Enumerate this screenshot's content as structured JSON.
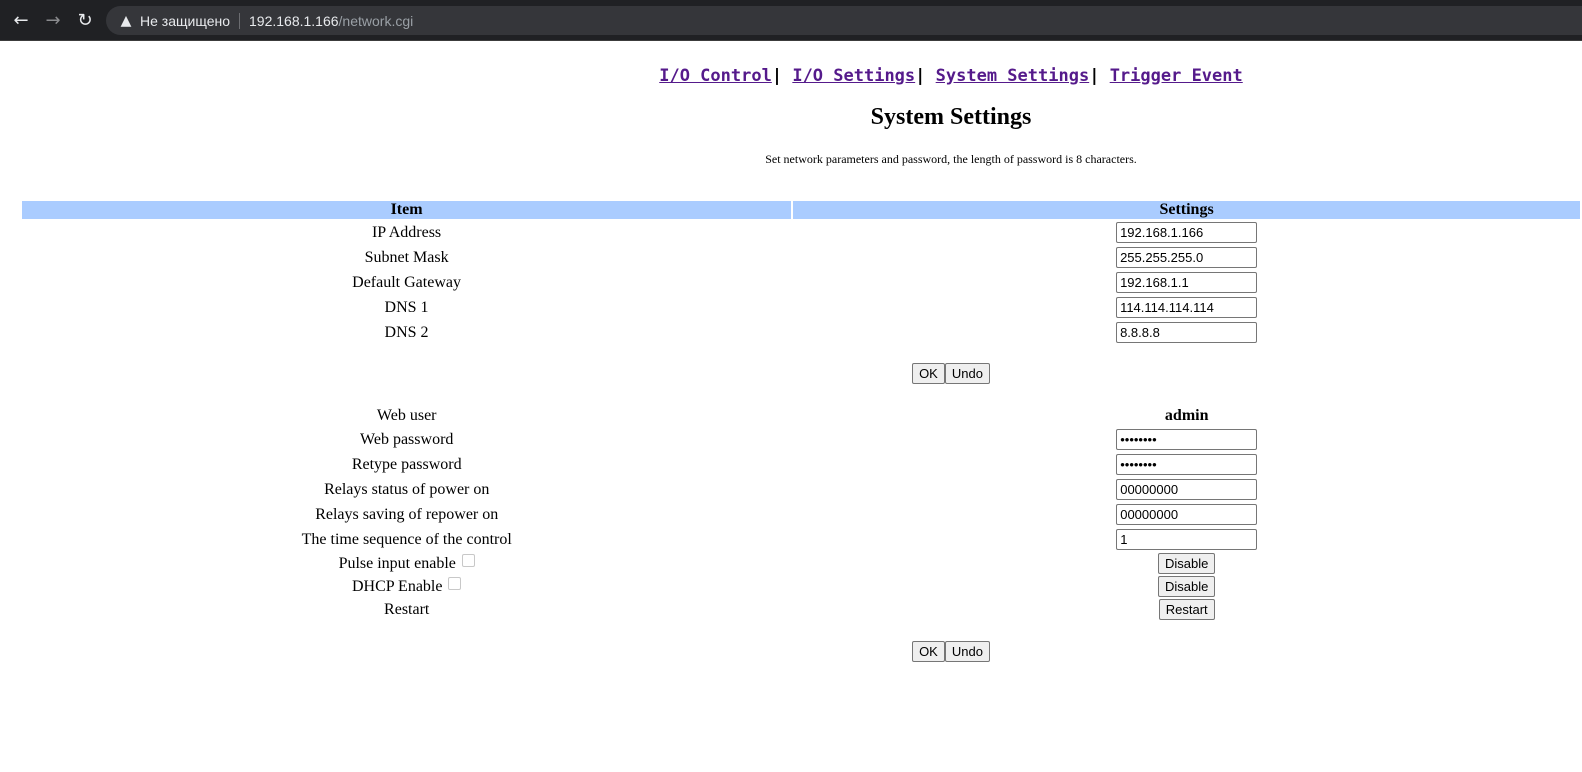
{
  "browser": {
    "not_secure_label": "Не защищено",
    "url_host": "192.168.1.166",
    "url_path": "/network.cgi"
  },
  "nav": {
    "io_control": "I/O Control",
    "io_settings": "I/O Settings",
    "system_settings": "System Settings",
    "trigger_event": "Trigger Event",
    "separator": "|"
  },
  "title": "System Settings",
  "description": "Set network parameters and password, the length of password is 8 characters.",
  "table_headers": {
    "item": "Item",
    "settings": "Settings"
  },
  "network": {
    "ip_label": "IP Address",
    "ip_value": "192.168.1.166",
    "mask_label": "Subnet Mask",
    "mask_value": "255.255.255.0",
    "gateway_label": "Default Gateway",
    "gateway_value": "192.168.1.1",
    "dns1_label": "DNS 1",
    "dns1_value": "114.114.114.114",
    "dns2_label": "DNS 2",
    "dns2_value": "8.8.8.8"
  },
  "buttons": {
    "ok": "OK",
    "undo": "Undo",
    "disable": "Disable",
    "restart": "Restart"
  },
  "account": {
    "web_user_label": "Web user",
    "web_user_value": "admin",
    "web_password_label": "Web password",
    "web_password_value": "********",
    "retype_password_label": "Retype password",
    "retype_password_value": "********",
    "relays_power_on_label": "Relays status of power on",
    "relays_power_on_value": "00000000",
    "relays_repower_label": "Relays saving of repower on",
    "relays_repower_value": "00000000",
    "time_sequence_label": "The time sequence of the control",
    "time_sequence_value": "1",
    "pulse_input_label": "Pulse input enable",
    "dhcp_label": "DHCP Enable",
    "restart_label": "Restart"
  }
}
